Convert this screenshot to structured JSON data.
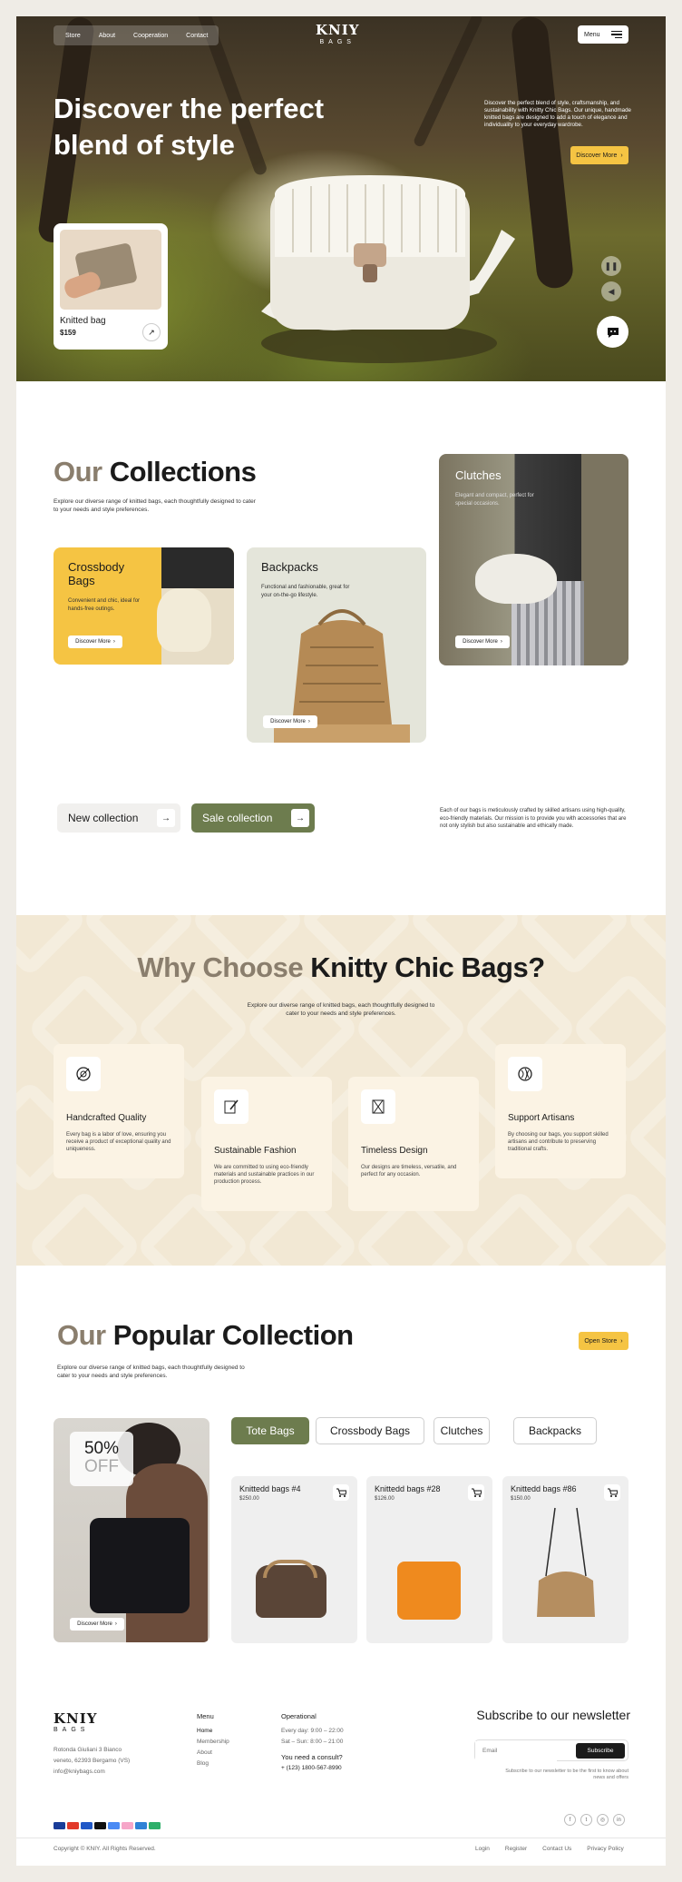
{
  "colors": {
    "accent_yellow": "#f5c443",
    "accent_green": "#6d7c4e",
    "beige": "#f2e8d4",
    "text": "#1b1b1b"
  },
  "hero": {
    "nav": [
      "Store",
      "About",
      "Cooperation",
      "Contact"
    ],
    "logo_top": "KNIY",
    "logo_bottom": "BAGS",
    "menu_label": "Menu",
    "title": "Discover the perfect blend of style",
    "desc": "Discover the perfect blend of style, craftsmanship, and sustainability with Knitty Chic Bags. Our unique, handmade knitted bags are designed to add a touch of elegance and individuality to your everyday wardrobe.",
    "cta": "Discover More",
    "card": {
      "name": "Knitted bag",
      "price": "$159"
    }
  },
  "collections": {
    "title_muted": "Our",
    "title_bold": "Collections",
    "desc": "Explore our diverse range of knitted bags, each thoughtfully designed to cater to your needs and style preferences.",
    "items": [
      {
        "name": "Crossbody Bags",
        "desc": "Convenient and chic, ideal for hands-free outings.",
        "cta": "Discover More"
      },
      {
        "name": "Backpacks",
        "desc": "Functional and fashionable, great for your on-the-go lifestyle.",
        "cta": "Discover More"
      },
      {
        "name": "Clutches",
        "desc": "Elegant and compact, perfect for special occasions.",
        "cta": "Discover More"
      }
    ],
    "btn_new": "New collection",
    "btn_sale": "Sale collection",
    "side_text": "Each of our bags is meticulously crafted by skilled artisans using high-quality, eco-friendly materials. Our mission is to provide you with accessories that are not only stylish but also sustainable and ethically made."
  },
  "why": {
    "title_muted": "Why Choose",
    "title_bold": "Knitty Chic Bags?",
    "desc": "Explore our diverse range of knitted bags, each thoughtfully designed to cater to your needs and style preferences.",
    "features": [
      {
        "title": "Handcrafted Quality",
        "desc": "Every bag is a labor of love, ensuring you receive a product of exceptional quality and uniqueness.",
        "icon": "needle-icon"
      },
      {
        "title": "Sustainable Fashion",
        "desc": "We are committed to using eco-friendly materials and sustainable practices in our production process.",
        "icon": "pencil-icon"
      },
      {
        "title": "Timeless Design",
        "desc": "Our designs are timeless, versatile, and perfect for any occasion.",
        "icon": "hourglass-icon"
      },
      {
        "title": "Support Artisans",
        "desc": "By choosing our bags, you support skilled artisans and contribute to preserving traditional crafts.",
        "icon": "yarn-icon"
      }
    ]
  },
  "popular": {
    "title_muted": "Our",
    "title_bold": "Popular Collection",
    "desc": "Explore our diverse range of knitted bags, each thoughtfully designed to cater to your needs and style preferences.",
    "open_store": "Open Store",
    "promo": {
      "line1": "50%",
      "line2": "OFF",
      "cta": "Discover More"
    },
    "tabs": [
      "Tote Bags",
      "Crossbody Bags",
      "Clutches",
      "Backpacks"
    ],
    "products": [
      {
        "name": "Knittedd bags #4",
        "price": "$250.00"
      },
      {
        "name": "Knittedd bags #28",
        "price": "$126.00"
      },
      {
        "name": "Knittedd bags #86",
        "price": "$150.00"
      }
    ]
  },
  "footer": {
    "address": [
      "Rotonda Giuliani 3 Bianco",
      "veneto, 62393 Bergamo (VS)",
      "info@kniybags.com"
    ],
    "menu_title": "Menu",
    "menu": [
      "Home",
      "Membership",
      "About",
      "Blog"
    ],
    "op_title": "Operational",
    "op": [
      "Every day: 9:00 – 22:00",
      "Sat – Sun: 8:00 – 21:00"
    ],
    "consult_title": "You need a consult?",
    "phone": "+ (123) 1800-567-8990",
    "news_title": "Subscribe to our newsletter",
    "email_placeholder": "Email",
    "subscribe": "Subscribe",
    "news_note": "Subscribe to our newsletter to be the first to know about news and offers",
    "copyright": "Copyright © KNIY. All Rights Reserved.",
    "links": [
      "Login",
      "Register",
      "Contact Us",
      "Privacy Policy"
    ]
  }
}
